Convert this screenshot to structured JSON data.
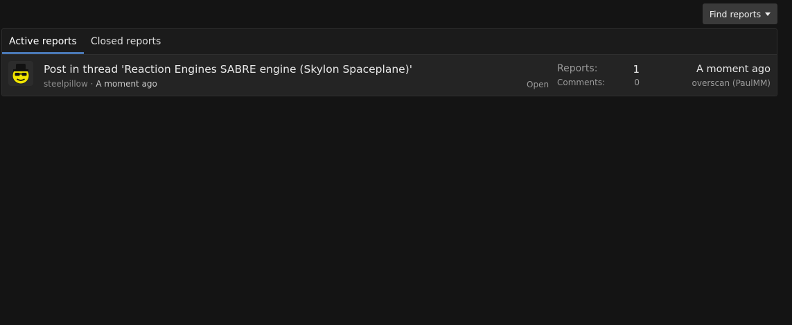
{
  "header": {
    "find_reports_label": "Find reports"
  },
  "tabs": [
    {
      "label": "Active reports",
      "active": true
    },
    {
      "label": "Closed reports",
      "active": false
    }
  ],
  "reports": [
    {
      "title": "Post in thread 'Reaction Engines SABRE engine (Skylon Spaceplane)'",
      "author": "steelpillow",
      "separator": "·",
      "time": "A moment ago",
      "status": "Open",
      "reports_label": "Reports:",
      "reports_count": "1",
      "comments_label": "Comments:",
      "comments_count": "0",
      "last_time": "A moment ago",
      "last_user": "overscan (PaulMM)"
    }
  ],
  "colors": {
    "background": "#141414",
    "panel": "#1d1d1d",
    "row": "#242424",
    "tab_accent": "#4a78b5",
    "button": "#3a3a3a",
    "avatar_face": "#f2e600"
  }
}
